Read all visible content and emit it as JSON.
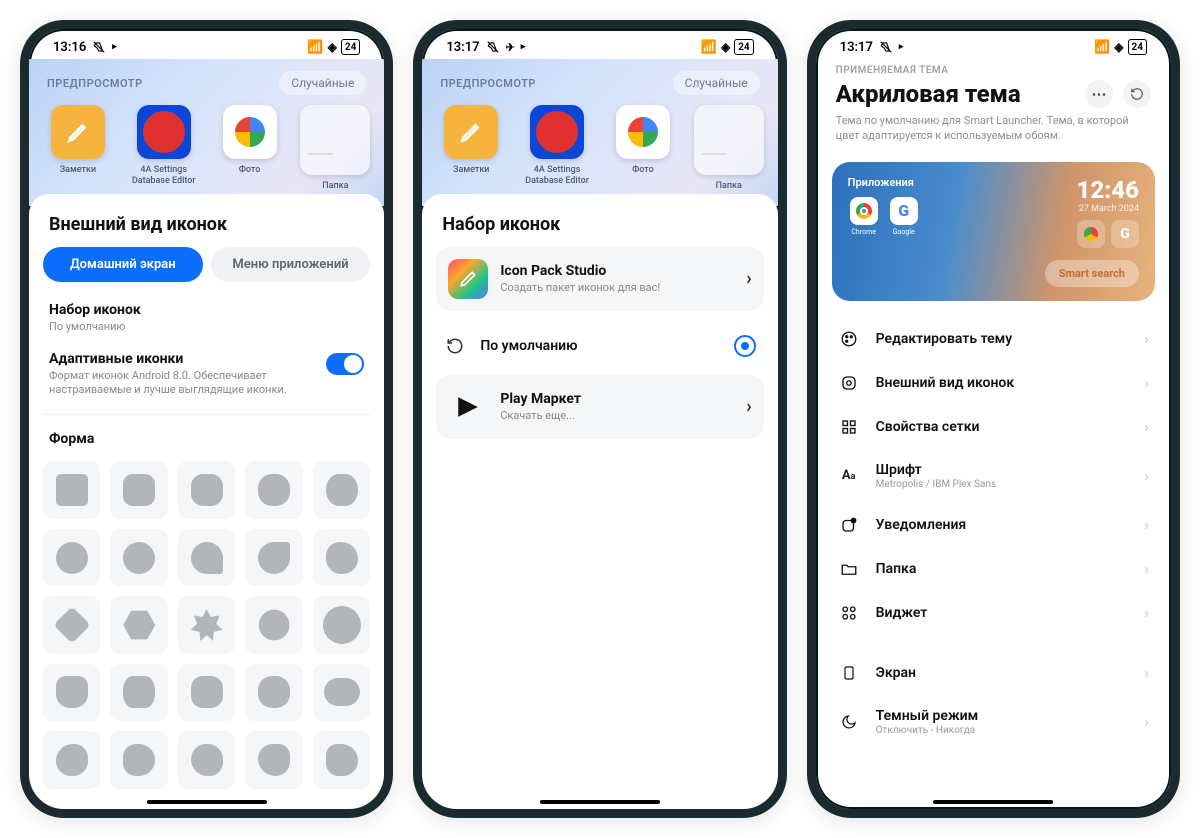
{
  "status": {
    "t1": "13:16",
    "t2": "13:17",
    "t3": "13:17",
    "battery": "24"
  },
  "preview": {
    "label": "ПРЕДПРОСМОТР",
    "random": "Случайные",
    "apps": [
      {
        "name": "Заметки"
      },
      {
        "name": "4A Settings Database Editor"
      },
      {
        "name": "Фото"
      },
      {
        "name": "Папка"
      }
    ]
  },
  "screen1": {
    "title": "Внешний вид иконок",
    "tab_home": "Домашний экран",
    "tab_apps": "Меню приложений",
    "iconset_title": "Набор иконок",
    "iconset_sub": "По умолчанию",
    "adaptive_title": "Адаптивные иконки",
    "adaptive_sub": "Формат иконок Android 8.0. Обеспечивает настраиваемые и лучше выглядящие иконки.",
    "shape_title": "Форма"
  },
  "screen2": {
    "title": "Набор иконок",
    "ips_title": "Icon Pack Studio",
    "ips_sub": "Создать пакет иконок для вас!",
    "default": "По умолчанию",
    "play_title": "Play Маркет",
    "play_sub": "Скачать еще..."
  },
  "screen3": {
    "overline": "ПРИМЕНЯЕМАЯ ТЕМА",
    "title": "Акриловая тема",
    "desc": "Тема по умолчанию для Smart Launcher. Тема, в которой цвет адаптируется к используемым обоям.",
    "widget": {
      "apps_label": "Приложения",
      "time": "12:46",
      "date": "27 March 2024",
      "app1": "Chrome",
      "app2": "Google",
      "search": "Smart search"
    },
    "menu": {
      "m1": "Редактировать тему",
      "m2": "Внешний вид иконок",
      "m3": "Свойства сетки",
      "m4": "Шрифт",
      "m4s": "Metropolis / IBM Plex Sans",
      "m5": "Уведомления",
      "m6": "Папка",
      "m7": "Виджет",
      "m8": "Экран",
      "m9": "Темный режим",
      "m9s": "Отключить - Никогда"
    }
  }
}
